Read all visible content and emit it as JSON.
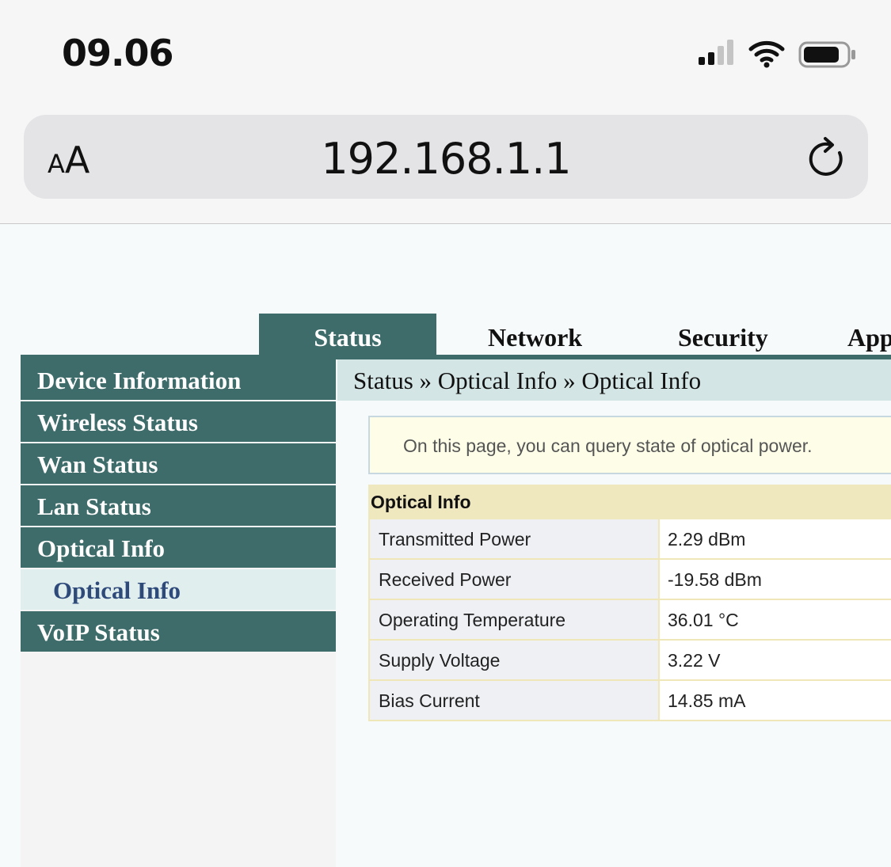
{
  "status_bar": {
    "time": "09.06",
    "icons": [
      "cellular-signal-icon",
      "wifi-icon",
      "battery-icon"
    ]
  },
  "browser": {
    "text_size_label_small": "A",
    "text_size_label_large": "A",
    "url": "192.168.1.1",
    "reload_icon": "reload-icon"
  },
  "nav": {
    "tabs": [
      "Status",
      "Network",
      "Security",
      "App"
    ],
    "active_tab": "Status"
  },
  "sidebar": {
    "items": [
      {
        "label": "Device Information"
      },
      {
        "label": "Wireless Status"
      },
      {
        "label": "Wan Status"
      },
      {
        "label": "Lan Status"
      },
      {
        "label": "Optical Info"
      },
      {
        "label": "Optical Info",
        "selected": true
      },
      {
        "label": "VoIP Status"
      }
    ]
  },
  "breadcrumb": "Status » Optical Info » Optical Info",
  "description": "On this page, you can query state of optical power.",
  "optical_table": {
    "header": "Optical Info",
    "rows": [
      {
        "label": "Transmitted Power",
        "value": "2.29 dBm"
      },
      {
        "label": "Received Power",
        "value": "-19.58 dBm"
      },
      {
        "label": "Operating Temperature",
        "value": "36.01 °C"
      },
      {
        "label": "Supply Voltage",
        "value": "3.22 V"
      },
      {
        "label": "Bias Current",
        "value": "14.85 mA"
      }
    ]
  },
  "colors": {
    "accent": "#3e6c6a",
    "breadcrumb_bg": "#d3e5e4",
    "table_header_bg": "#efe8bf",
    "selected_item_text": "#2e4a7a"
  }
}
